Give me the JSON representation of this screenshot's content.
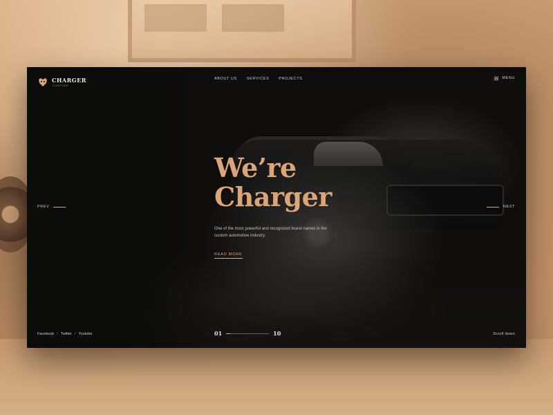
{
  "brand": {
    "name": "CHARGER",
    "tagline": "CUSTOMS"
  },
  "nav": {
    "items": [
      "ABOUT US",
      "SERVICES",
      "PROJECTS"
    ],
    "menu_label": "MENU"
  },
  "hero": {
    "title_line1": "We’re",
    "title_line2": "Charger",
    "description": "One of the most powerful and recognized brand names in the custom automotive industry.",
    "cta": "READ MORE"
  },
  "slider": {
    "prev_label": "PREV",
    "next_label": "NEXT",
    "current": "01",
    "total": "10",
    "progress": 0.1
  },
  "social": {
    "links": [
      "Facebook",
      "Twitter",
      "Youtube"
    ],
    "separator": "/"
  },
  "scroll_label": "Scroll down",
  "colors": {
    "accent": "#dba577",
    "background": "#0e0d0c",
    "backdrop": "#c99a6e"
  },
  "icons": {
    "logo": "bulldog-icon",
    "menu": "hamburger-icon"
  }
}
